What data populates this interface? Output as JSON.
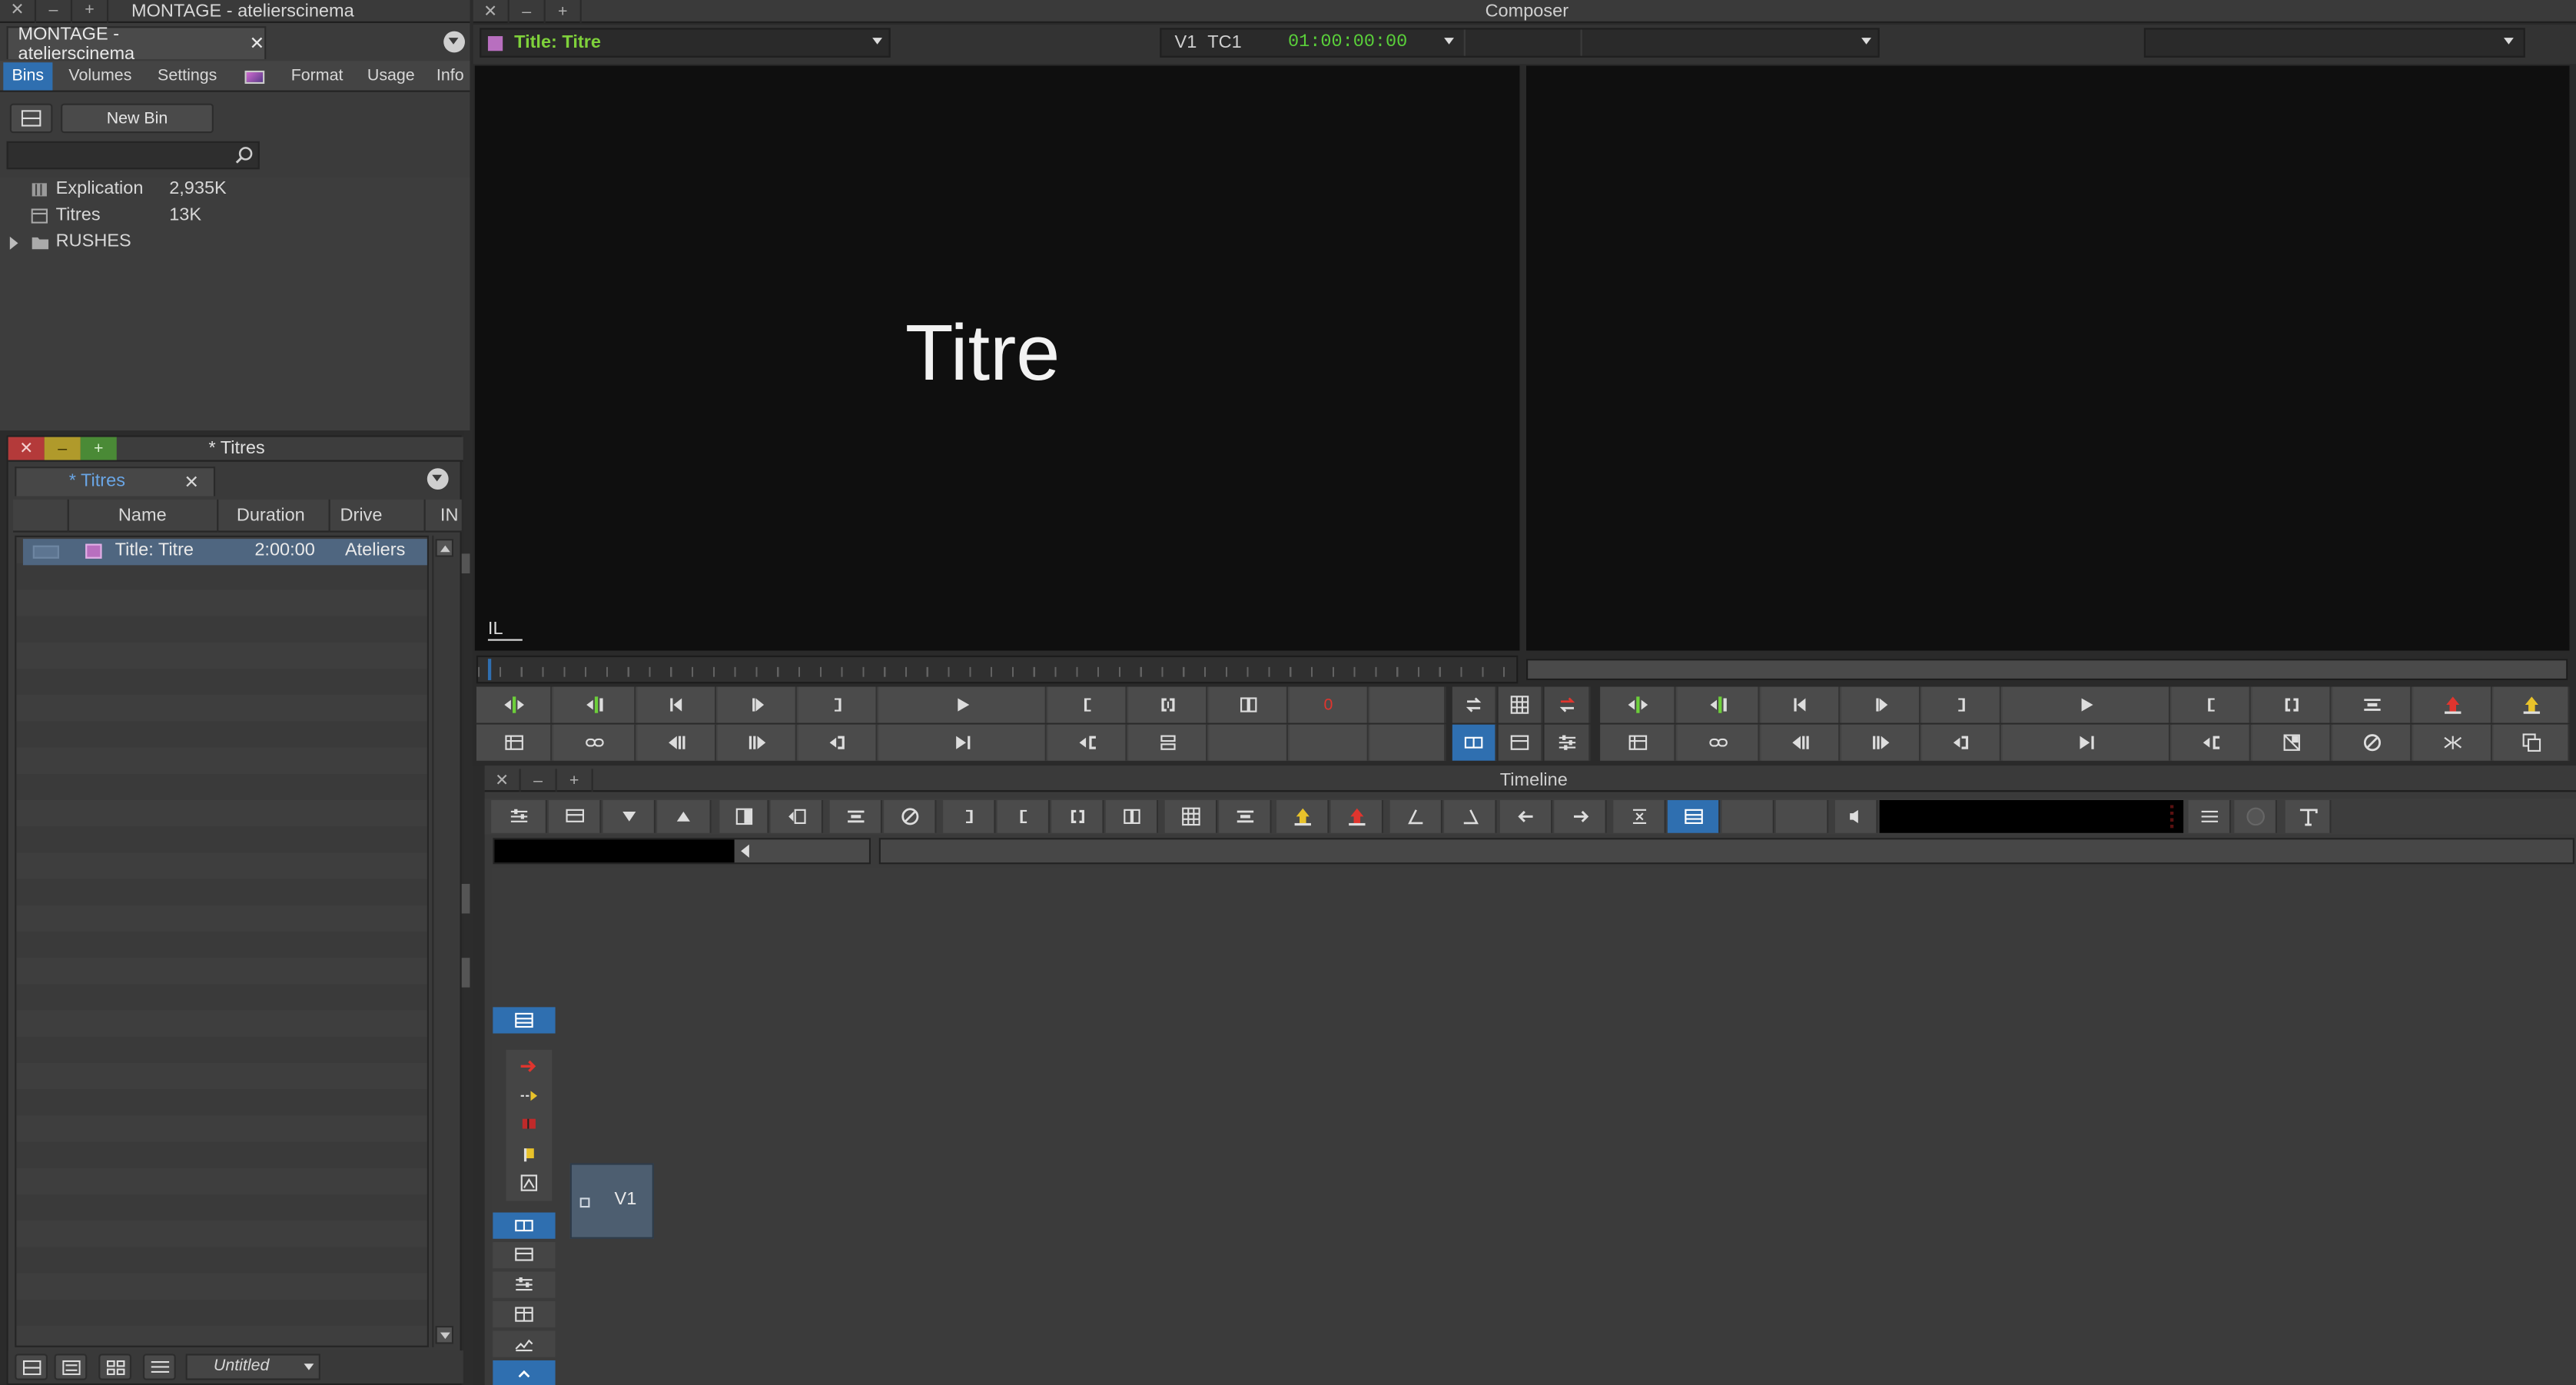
{
  "project": {
    "window_title": "MONTAGE - atelierscinema",
    "tab_label": "MONTAGE - atelierscinema",
    "close_glyph": "✕",
    "tabs": [
      "Bins",
      "Volumes",
      "Settings",
      "",
      "Format",
      "Usage",
      "Info"
    ],
    "new_bin_label": "New Bin",
    "search_placeholder": "",
    "items": [
      {
        "name": "Explication",
        "size": "2,935K",
        "icon": "bin-icon"
      },
      {
        "name": "Titres",
        "size": "13K",
        "icon": "bin-icon"
      },
      {
        "name": "RUSHES",
        "size": "",
        "icon": "folder-icon"
      }
    ]
  },
  "bin": {
    "window_title": "* Titres",
    "tab_label": "* Titres",
    "columns": [
      "Name",
      "Duration",
      "Drive",
      "IN"
    ],
    "rows": [
      {
        "name": "Title: Titre",
        "duration": "2:00:00",
        "drive": "Ateliers"
      }
    ],
    "view_label": "Untitled"
  },
  "composer": {
    "window_title": "Composer",
    "source_title": "Title: Titre",
    "track_label": "V1",
    "tc_label": "TC1",
    "timecode": "01:00:00:00",
    "record_title": "",
    "monitor_text": "Titre",
    "red_marker": "0",
    "corner_mark": "IL"
  },
  "timeline": {
    "window_title": "Timeline",
    "track_name": "V1"
  },
  "colors": {
    "accent_blue": "#2f6fb0",
    "timecode_green": "#5ad03a",
    "source_title_green": "#7fd13b",
    "close_red": "#b43a3a",
    "min_yellow": "#b09a2b",
    "add_green": "#4a8a36"
  }
}
